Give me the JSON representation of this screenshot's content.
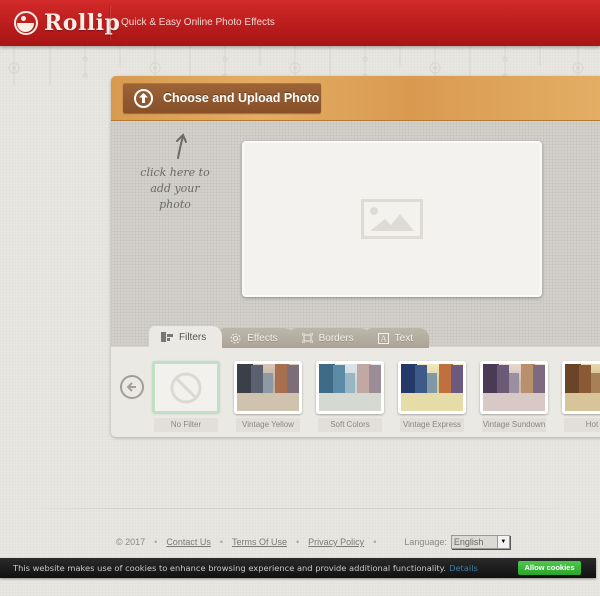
{
  "header": {
    "logo_text": "Rollip",
    "tagline": "Quick & Easy Online Photo Effects",
    "brand_color": "#c42020"
  },
  "editor": {
    "upload_button_label": "Choose and Upload Photo",
    "hint_line1": "click here to",
    "hint_line2": "add your photo",
    "tabs": [
      {
        "label": "Filters",
        "icon": "filters-icon",
        "active": true
      },
      {
        "label": "Effects",
        "icon": "gear-flower-icon",
        "active": false
      },
      {
        "label": "Borders",
        "icon": "border-frame-icon",
        "active": false
      },
      {
        "label": "Text",
        "icon": "text-a-icon",
        "active": false
      }
    ],
    "filters": [
      {
        "label": "No Filter",
        "selected": true
      },
      {
        "label": "Vintage Yellow",
        "selected": false
      },
      {
        "label": "Soft Colors",
        "selected": false
      },
      {
        "label": "Vintage Express",
        "selected": false
      },
      {
        "label": "Vintage Sundown",
        "selected": false
      },
      {
        "label": "Hot D",
        "selected": false
      }
    ]
  },
  "footer": {
    "copyright": "© 2017",
    "links": [
      "Contact Us",
      "Terms Of Use",
      "Privacy Policy"
    ],
    "language_label": "Language:",
    "language_value": "English"
  },
  "cookie_bar": {
    "message": "This website makes use of cookies to enhance browsing experience and provide additional functionality.",
    "details_link": "Details",
    "allow_button": "Allow cookies",
    "allow_color": "#3bb83b"
  }
}
